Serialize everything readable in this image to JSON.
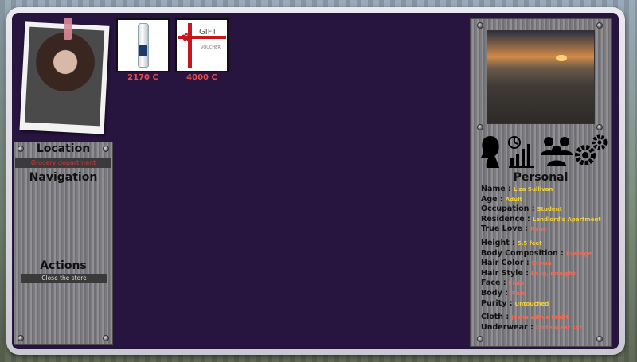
{
  "inventory": [
    {
      "name": "vodka-bottle",
      "price": "2170 C",
      "label": "SMIRNA"
    },
    {
      "name": "gift-voucher",
      "price": "4000 C",
      "title": "GIFT",
      "subtitle": "VOUCHER"
    }
  ],
  "left_panel": {
    "location_heading": "Location",
    "location_value": "Grocery department",
    "navigation_heading": "Navigation",
    "actions_heading": "Actions",
    "action_close": "Close the store"
  },
  "personal": {
    "heading": "Personal",
    "rows": [
      {
        "label": "Name :",
        "value": "Liza Sullivan"
      },
      {
        "label": "Age :",
        "value": "Adult"
      },
      {
        "label": "Occupation :",
        "value": "Student"
      },
      {
        "label": "Residence :",
        "value": "Landlord's Apartment"
      },
      {
        "label": "True Love :",
        "value": "None"
      },
      {
        "label": "Height :",
        "value": "5.5 feet"
      },
      {
        "label": "Body Composition :",
        "value": "Average"
      },
      {
        "label": "Hair Color :",
        "value": "Brown"
      },
      {
        "label": "Hair Style :",
        "value": "Long, straight"
      },
      {
        "label": "Face :",
        "value": "Plain"
      },
      {
        "label": "Body :",
        "value": "Plain"
      },
      {
        "label": "Purity :",
        "value": "Untouched"
      },
      {
        "label": "Cloth :",
        "value": "Jeans with a tshirt"
      },
      {
        "label": "Underwear :",
        "value": "Underwear set"
      }
    ]
  },
  "colors": {
    "background": "#271540",
    "price": "#e84a4a",
    "accent_yellow": "#f2d23a",
    "accent_red": "#ea6d5a"
  },
  "icons": [
    "woman-silhouette-icon",
    "stats-chart-icon",
    "people-group-icon",
    "gears-icon"
  ]
}
